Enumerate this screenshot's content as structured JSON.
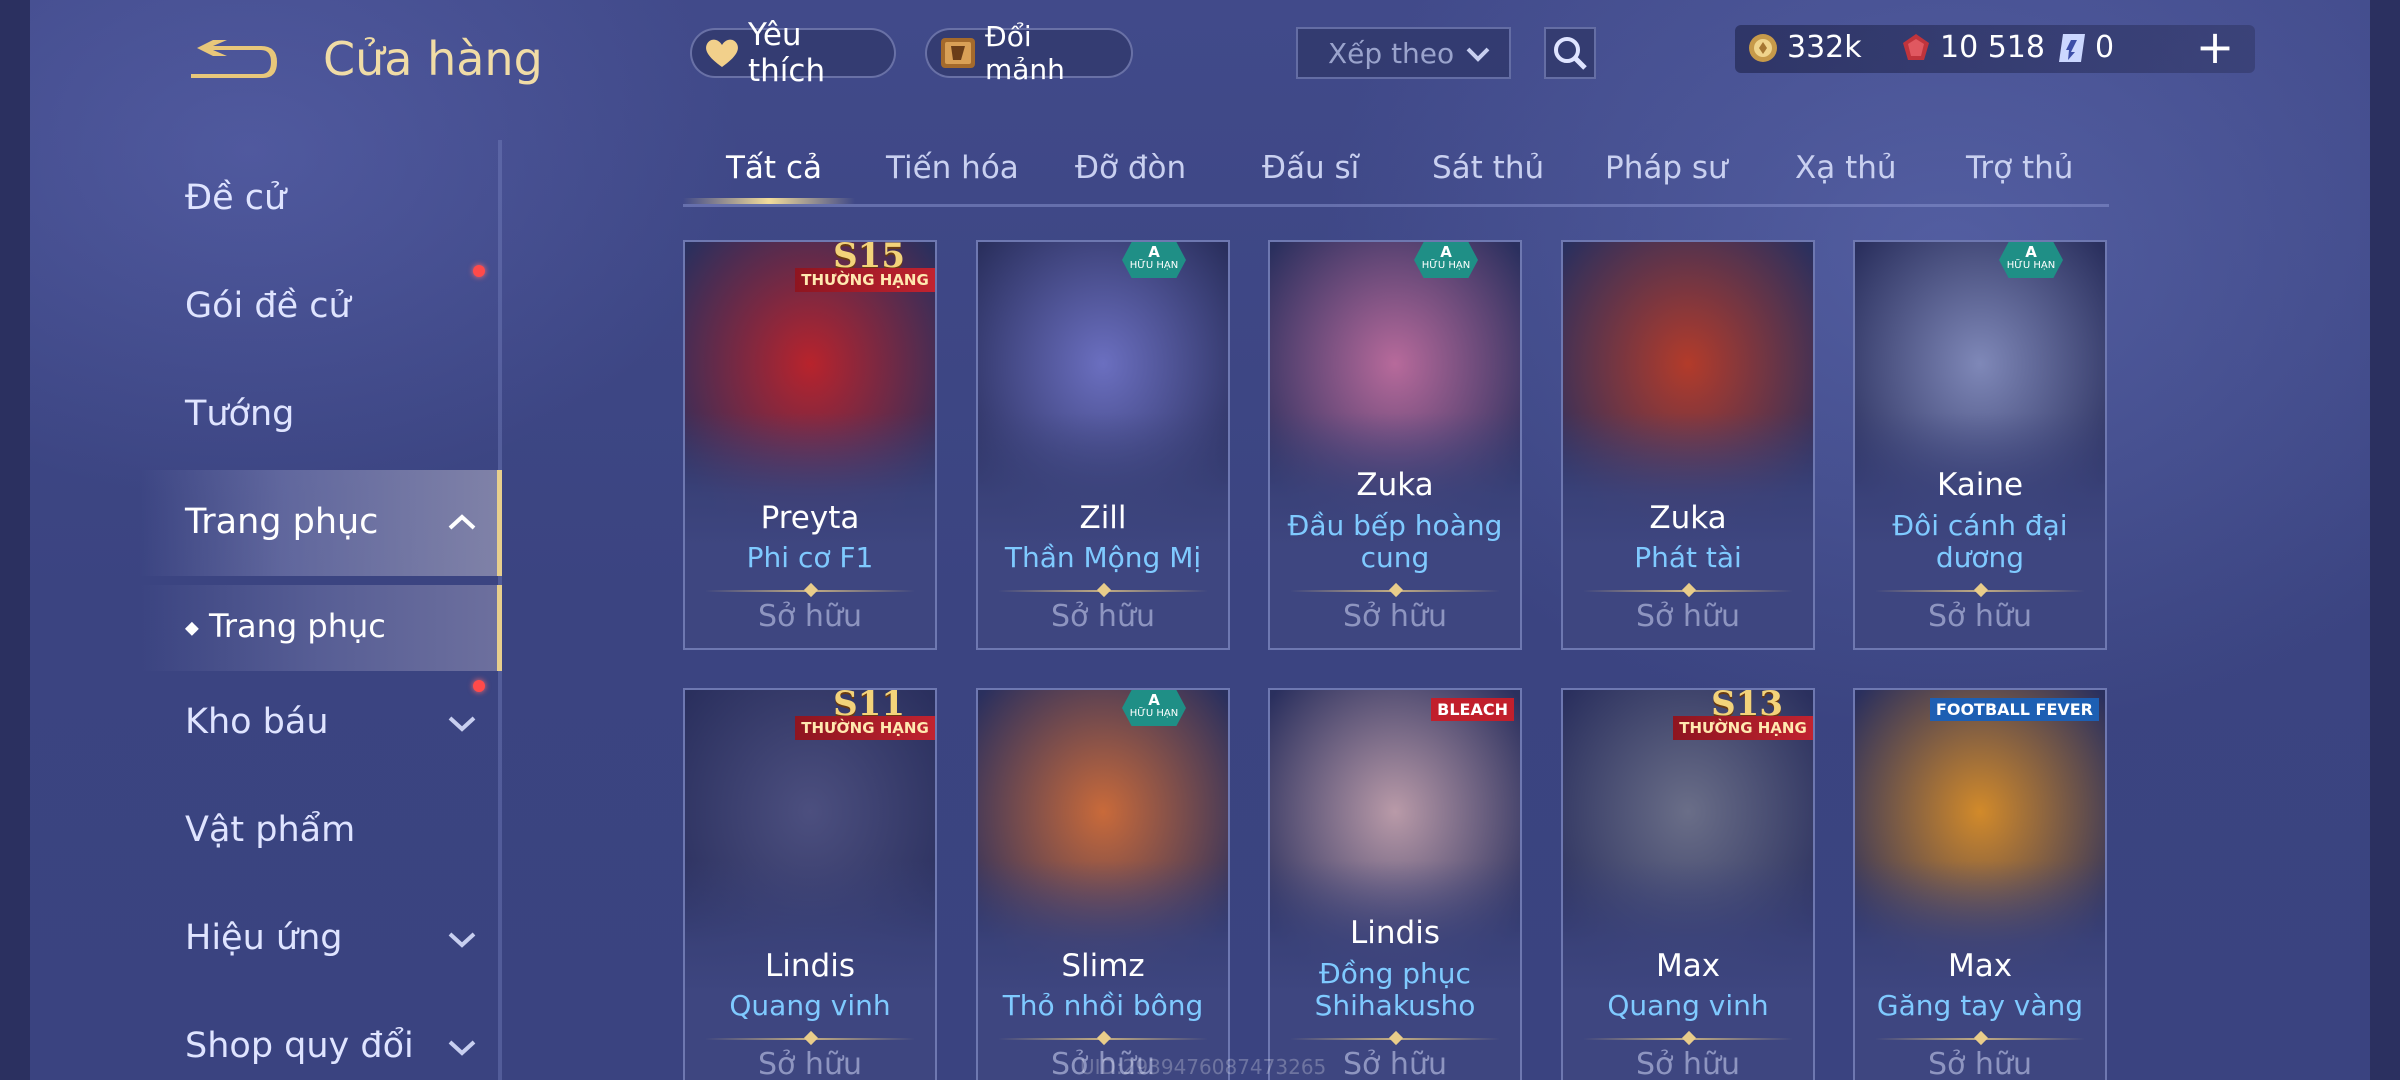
{
  "header": {
    "title": "Cửa hàng",
    "favorite_label": "Yêu thích",
    "exchange_label": "Đổi mảnh",
    "sort_placeholder": "Xếp theo"
  },
  "currency": {
    "gold": "332k",
    "vouchers": "10 518",
    "tickets": "0"
  },
  "sidebar": {
    "items": [
      {
        "label": "Đề cử"
      },
      {
        "label": "Gói đề cử"
      },
      {
        "label": "Tướng"
      },
      {
        "label": "Trang phục"
      },
      {
        "label": "Trang phục"
      },
      {
        "label": "Kho báu"
      },
      {
        "label": "Vật phẩm"
      },
      {
        "label": "Hiệu ứng"
      },
      {
        "label": "Shop quy đổi"
      }
    ]
  },
  "tabs": [
    {
      "label": "Tất cả"
    },
    {
      "label": "Tiến hóa"
    },
    {
      "label": "Đỡ đòn"
    },
    {
      "label": "Đấu sĩ"
    },
    {
      "label": "Sát thủ"
    },
    {
      "label": "Pháp sư"
    },
    {
      "label": "Xạ thủ"
    },
    {
      "label": "Trợ thủ"
    }
  ],
  "cards": [
    {
      "hero": "Preyta",
      "skin": "Phi cơ F1",
      "status": "Sở hữu",
      "badge_top": "S15",
      "badge_band": "THƯỜNG HẠNG",
      "color": "#b8232c"
    },
    {
      "hero": "Zill",
      "skin": "Thần Mộng Mị",
      "status": "Sở hữu",
      "limited_top": "A",
      "limited_sub": "HỮU HẠN",
      "color": "#6b6fc0"
    },
    {
      "hero": "Zuka",
      "skin": "Đầu bếp hoàng",
      "skin2": "cung",
      "status": "Sở hữu",
      "limited_top": "A",
      "limited_sub": "HỮU HẠN",
      "color": "#b76a9b"
    },
    {
      "hero": "Zuka",
      "skin": "Phát tài",
      "status": "Sở hữu",
      "color": "#b33b2a"
    },
    {
      "hero": "Kaine",
      "skin": "Đôi cánh đại",
      "skin2": "dương",
      "status": "Sở hữu",
      "limited_top": "A",
      "limited_sub": "HỮU HẠN",
      "color": "#7f88b8"
    },
    {
      "hero": "Lindis",
      "skin": "Quang vinh",
      "status": "Sở hữu",
      "badge_top": "S11",
      "badge_band": "THƯỜNG HẠNG",
      "color": "#4c4f7f"
    },
    {
      "hero": "Slimz",
      "skin": "Thỏ nhồi bông",
      "status": "Sở hữu",
      "limited_top": "A",
      "limited_sub": "HỮU HẠN",
      "color": "#c96a3a"
    },
    {
      "hero": "Lindis",
      "skin": "Đồng phục",
      "skin2": "Shihakusho",
      "status": "Sở hữu",
      "event": "BLEACH",
      "color": "#b99aa8"
    },
    {
      "hero": "Max",
      "skin": "Quang vinh",
      "status": "Sở hữu",
      "badge_top": "S13",
      "badge_band": "THƯỜNG HẠNG",
      "color": "#6a6e88"
    },
    {
      "hero": "Max",
      "skin": "Găng tay vàng",
      "status": "Sở hữu",
      "event": "FOOTBALL FEVER",
      "color": "#d28a2a"
    }
  ],
  "footer": {
    "uid": "UID:2939476087473265"
  }
}
